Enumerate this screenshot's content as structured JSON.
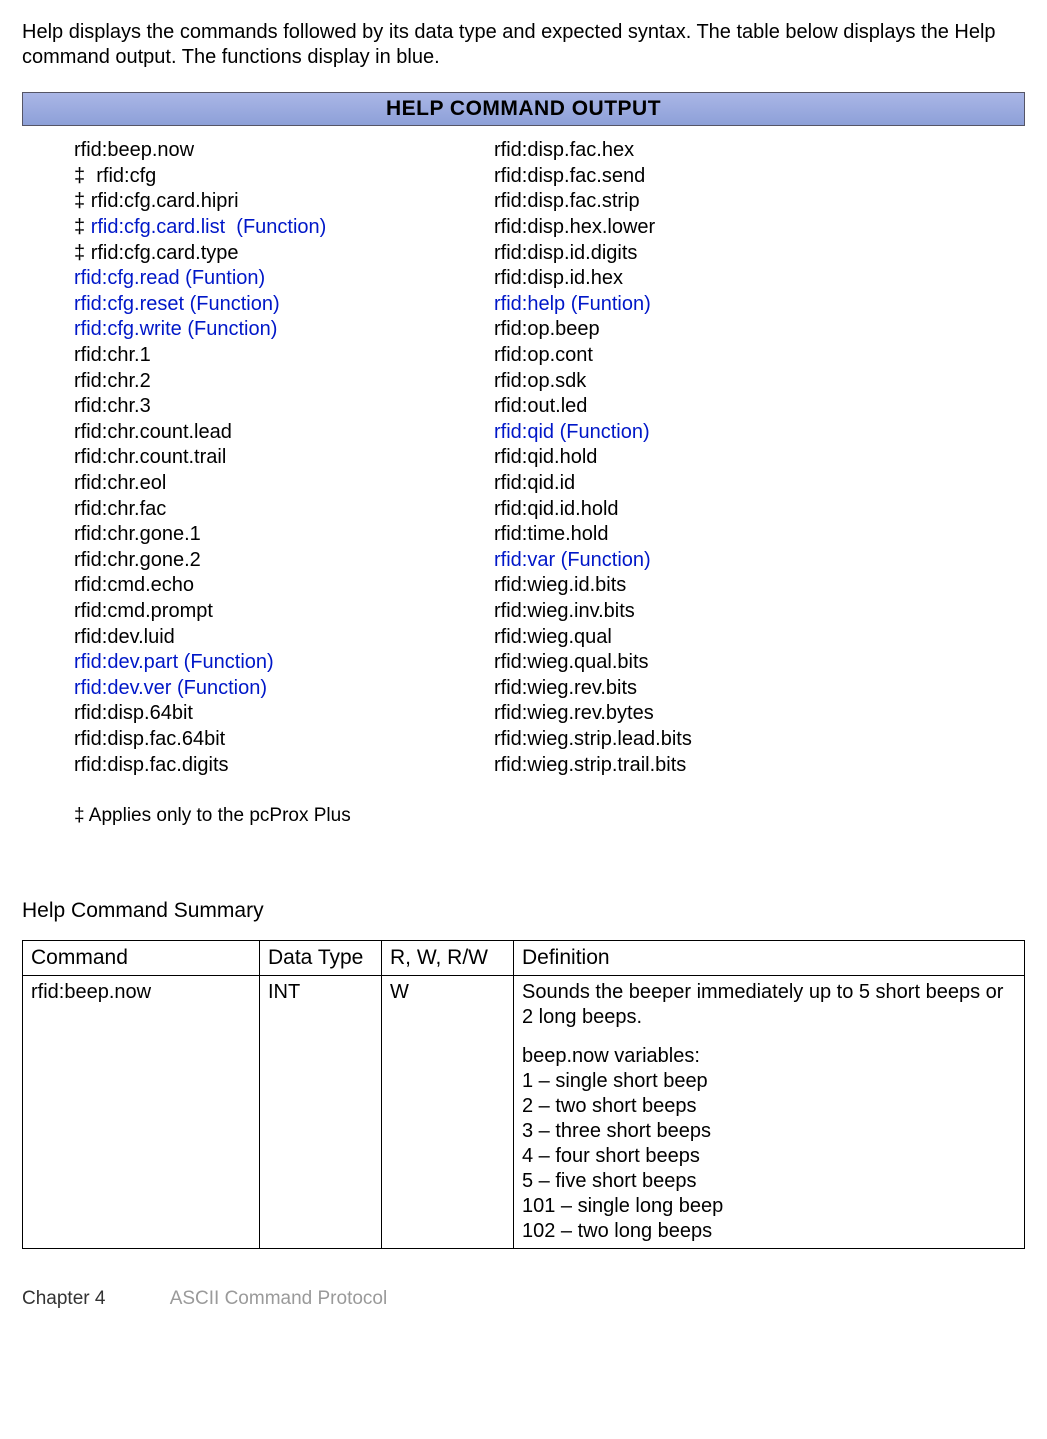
{
  "intro": "Help displays the commands followed by its data type and expected syntax. The table below displays the Help command output. The functions display in blue.",
  "help_header": "HELP COMMAND OUTPUT",
  "columns": {
    "left": [
      {
        "prefix": "",
        "text": "rfid:beep.now",
        "fn": false
      },
      {
        "prefix": "‡  ",
        "text": "rfid:cfg",
        "fn": false
      },
      {
        "prefix": "‡ ",
        "text": "rfid:cfg.card.hipri",
        "fn": false
      },
      {
        "prefix": "‡ ",
        "text": "rfid:cfg.card.list  (Function)",
        "fn": true
      },
      {
        "prefix": "‡ ",
        "text": "rfid:cfg.card.type",
        "fn": false
      },
      {
        "prefix": "",
        "text": "rfid:cfg.read (Funtion)",
        "fn": true
      },
      {
        "prefix": "",
        "text": "rfid:cfg.reset (Function)",
        "fn": true
      },
      {
        "prefix": "",
        "text": "rfid:cfg.write (Function)",
        "fn": true
      },
      {
        "prefix": "",
        "text": "rfid:chr.1",
        "fn": false
      },
      {
        "prefix": "",
        "text": "rfid:chr.2",
        "fn": false
      },
      {
        "prefix": "",
        "text": "rfid:chr.3",
        "fn": false
      },
      {
        "prefix": "",
        "text": "rfid:chr.count.lead",
        "fn": false
      },
      {
        "prefix": "",
        "text": "rfid:chr.count.trail",
        "fn": false
      },
      {
        "prefix": "",
        "text": "rfid:chr.eol",
        "fn": false
      },
      {
        "prefix": "",
        "text": "rfid:chr.fac",
        "fn": false
      },
      {
        "prefix": "",
        "text": "rfid:chr.gone.1",
        "fn": false
      },
      {
        "prefix": "",
        "text": "rfid:chr.gone.2",
        "fn": false
      },
      {
        "prefix": "",
        "text": "rfid:cmd.echo",
        "fn": false
      },
      {
        "prefix": "",
        "text": "rfid:cmd.prompt",
        "fn": false
      },
      {
        "prefix": "",
        "text": "rfid:dev.luid",
        "fn": false
      },
      {
        "prefix": "",
        "text": "rfid:dev.part (Function)",
        "fn": true
      },
      {
        "prefix": "",
        "text": "rfid:dev.ver (Function)",
        "fn": true
      },
      {
        "prefix": "",
        "text": "rfid:disp.64bit",
        "fn": false
      },
      {
        "prefix": "",
        "text": "rfid:disp.fac.64bit",
        "fn": false
      },
      {
        "prefix": "",
        "text": "rfid:disp.fac.digits",
        "fn": false
      }
    ],
    "right": [
      {
        "text": "rfid:disp.fac.hex",
        "fn": false
      },
      {
        "text": "rfid:disp.fac.send",
        "fn": false
      },
      {
        "text": "rfid:disp.fac.strip",
        "fn": false
      },
      {
        "text": "rfid:disp.hex.lower",
        "fn": false
      },
      {
        "text": "rfid:disp.id.digits",
        "fn": false
      },
      {
        "text": "rfid:disp.id.hex",
        "fn": false
      },
      {
        "text": "rfid:help (Funtion)",
        "fn": true
      },
      {
        "text": "rfid:op.beep",
        "fn": false
      },
      {
        "text": "rfid:op.cont",
        "fn": false
      },
      {
        "text": "rfid:op.sdk",
        "fn": false
      },
      {
        "text": "rfid:out.led",
        "fn": false
      },
      {
        "text": "rfid:qid (Function)",
        "fn": true
      },
      {
        "text": "rfid:qid.hold",
        "fn": false
      },
      {
        "text": "rfid:qid.id",
        "fn": false
      },
      {
        "text": "rfid:qid.id.hold",
        "fn": false
      },
      {
        "text": "rfid:time.hold",
        "fn": false
      },
      {
        "text": "rfid:var (Function)",
        "fn": true
      },
      {
        "text": "rfid:wieg.id.bits",
        "fn": false
      },
      {
        "text": "rfid:wieg.inv.bits",
        "fn": false
      },
      {
        "text": "rfid:wieg.qual",
        "fn": false
      },
      {
        "text": "rfid:wieg.qual.bits",
        "fn": false
      },
      {
        "text": "rfid:wieg.rev.bits",
        "fn": false
      },
      {
        "text": "rfid:wieg.rev.bytes",
        "fn": false
      },
      {
        "text": "rfid:wieg.strip.lead.bits",
        "fn": false
      },
      {
        "text": "rfid:wieg.strip.trail.bits",
        "fn": false
      }
    ]
  },
  "footnote": "‡ Applies only to the pcProx Plus",
  "summary_title": "Help Command Summary",
  "table": {
    "headers": {
      "command": "Command",
      "datatype": "Data Type",
      "rw": "R, W, R/W",
      "definition": "Definition"
    },
    "row": {
      "command": "rfid:beep.now",
      "datatype": "INT",
      "rw": "W",
      "def_lines": [
        "Sounds the beeper immediately  up to 5 short beeps or 2 long beeps.",
        "",
        "beep.now variables:",
        "1 – single short beep",
        "2 – two short beeps",
        "3 – three short beeps",
        "4 – four short beeps",
        "5 – five short beeps",
        "101 – single long beep",
        "102 – two long beeps"
      ]
    }
  },
  "footer": {
    "chapter": "Chapter 4",
    "section": "ASCII Command Protocol"
  }
}
